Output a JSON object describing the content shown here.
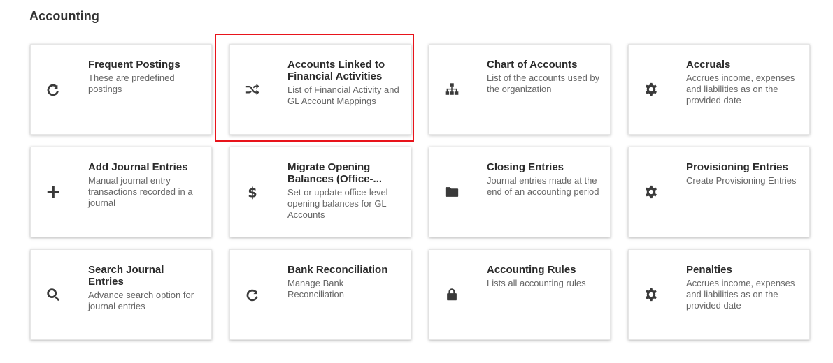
{
  "page": {
    "title": "Accounting"
  },
  "colors": {
    "highlight": "#e8141b",
    "icon": "#3a3a3a"
  },
  "cards": [
    {
      "title": "Frequent Postings",
      "description": "These are predefined postings",
      "icon": "redo-icon"
    },
    {
      "title": "Accounts Linked to Financial Activities",
      "description": "List of Financial Activity and GL Account Mappings",
      "icon": "shuffle-icon",
      "highlighted": true
    },
    {
      "title": "Chart of Accounts",
      "description": "List of the accounts used by the organization",
      "icon": "sitemap-icon"
    },
    {
      "title": "Accruals",
      "description": "Accrues income, expenses and liabilities as on the provided date",
      "icon": "gear-icon"
    },
    {
      "title": "Add Journal Entries",
      "description": "Manual journal entry transactions recorded in a journal",
      "icon": "plus-icon"
    },
    {
      "title": "Migrate Opening Balances (Office-...",
      "description": "Set or update office-level opening balances for GL Accounts",
      "icon": "dollar-icon"
    },
    {
      "title": "Closing Entries",
      "description": "Journal entries made at the end of an accounting period",
      "icon": "folder-icon"
    },
    {
      "title": "Provisioning Entries",
      "description": "Create Provisioning Entries",
      "icon": "gear-icon"
    },
    {
      "title": "Search Journal Entries",
      "description": "Advance search option for journal entries",
      "icon": "search-icon"
    },
    {
      "title": "Bank Reconciliation",
      "description": "Manage Bank Reconciliation",
      "icon": "redo-icon"
    },
    {
      "title": "Accounting Rules",
      "description": "Lists all accounting rules",
      "icon": "lock-icon"
    },
    {
      "title": "Penalties",
      "description": "Accrues income, expenses and liabilities as on the provided date",
      "icon": "gear-icon"
    }
  ]
}
